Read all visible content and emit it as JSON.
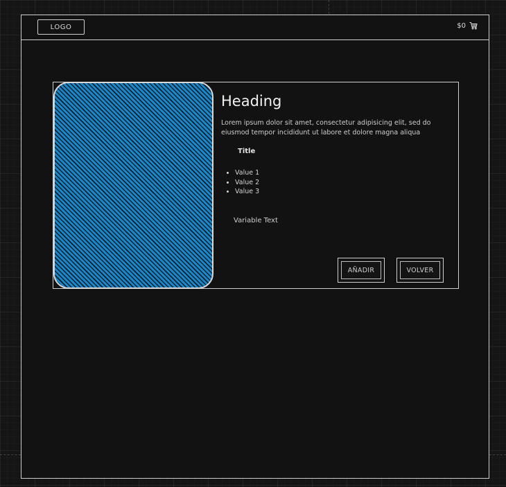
{
  "navbar": {
    "logo_label": "LOGO",
    "cart_total": "$0",
    "cart_icon": "shopping-cart-icon"
  },
  "product": {
    "image_icon": "image-placeholder",
    "heading": "Heading",
    "description": "Lorem ipsum dolor sit amet, consectetur adipisicing elit, sed do eiusmod tempor incididunt ut labore et dolore magna aliqua",
    "list_title": "Title",
    "values": [
      "Value 1",
      "Value 2",
      "Value 3"
    ],
    "variable_text": "Variable Text",
    "add_label": "AÑADIR",
    "back_label": "VOLVER"
  },
  "colors": {
    "background": "#121212",
    "accent_blue": "#1b87c9",
    "stroke": "#cfcfcf"
  }
}
